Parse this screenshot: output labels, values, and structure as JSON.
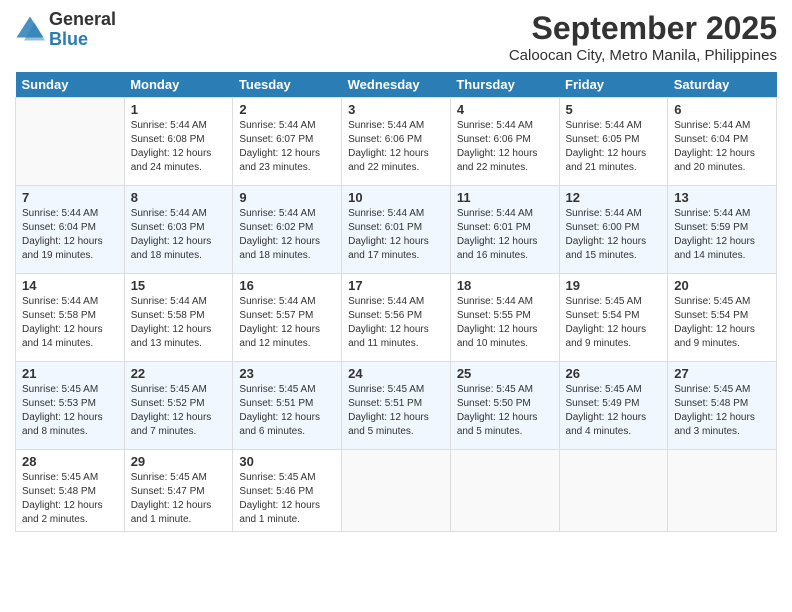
{
  "logo": {
    "general": "General",
    "blue": "Blue"
  },
  "title": "September 2025",
  "subtitle": "Caloocan City, Metro Manila, Philippines",
  "days_header": [
    "Sunday",
    "Monday",
    "Tuesday",
    "Wednesday",
    "Thursday",
    "Friday",
    "Saturday"
  ],
  "weeks": [
    [
      {
        "num": "",
        "info": ""
      },
      {
        "num": "1",
        "info": "Sunrise: 5:44 AM\nSunset: 6:08 PM\nDaylight: 12 hours\nand 24 minutes."
      },
      {
        "num": "2",
        "info": "Sunrise: 5:44 AM\nSunset: 6:07 PM\nDaylight: 12 hours\nand 23 minutes."
      },
      {
        "num": "3",
        "info": "Sunrise: 5:44 AM\nSunset: 6:06 PM\nDaylight: 12 hours\nand 22 minutes."
      },
      {
        "num": "4",
        "info": "Sunrise: 5:44 AM\nSunset: 6:06 PM\nDaylight: 12 hours\nand 22 minutes."
      },
      {
        "num": "5",
        "info": "Sunrise: 5:44 AM\nSunset: 6:05 PM\nDaylight: 12 hours\nand 21 minutes."
      },
      {
        "num": "6",
        "info": "Sunrise: 5:44 AM\nSunset: 6:04 PM\nDaylight: 12 hours\nand 20 minutes."
      }
    ],
    [
      {
        "num": "7",
        "info": "Sunrise: 5:44 AM\nSunset: 6:04 PM\nDaylight: 12 hours\nand 19 minutes."
      },
      {
        "num": "8",
        "info": "Sunrise: 5:44 AM\nSunset: 6:03 PM\nDaylight: 12 hours\nand 18 minutes."
      },
      {
        "num": "9",
        "info": "Sunrise: 5:44 AM\nSunset: 6:02 PM\nDaylight: 12 hours\nand 18 minutes."
      },
      {
        "num": "10",
        "info": "Sunrise: 5:44 AM\nSunset: 6:01 PM\nDaylight: 12 hours\nand 17 minutes."
      },
      {
        "num": "11",
        "info": "Sunrise: 5:44 AM\nSunset: 6:01 PM\nDaylight: 12 hours\nand 16 minutes."
      },
      {
        "num": "12",
        "info": "Sunrise: 5:44 AM\nSunset: 6:00 PM\nDaylight: 12 hours\nand 15 minutes."
      },
      {
        "num": "13",
        "info": "Sunrise: 5:44 AM\nSunset: 5:59 PM\nDaylight: 12 hours\nand 14 minutes."
      }
    ],
    [
      {
        "num": "14",
        "info": "Sunrise: 5:44 AM\nSunset: 5:58 PM\nDaylight: 12 hours\nand 14 minutes."
      },
      {
        "num": "15",
        "info": "Sunrise: 5:44 AM\nSunset: 5:58 PM\nDaylight: 12 hours\nand 13 minutes."
      },
      {
        "num": "16",
        "info": "Sunrise: 5:44 AM\nSunset: 5:57 PM\nDaylight: 12 hours\nand 12 minutes."
      },
      {
        "num": "17",
        "info": "Sunrise: 5:44 AM\nSunset: 5:56 PM\nDaylight: 12 hours\nand 11 minutes."
      },
      {
        "num": "18",
        "info": "Sunrise: 5:44 AM\nSunset: 5:55 PM\nDaylight: 12 hours\nand 10 minutes."
      },
      {
        "num": "19",
        "info": "Sunrise: 5:45 AM\nSunset: 5:54 PM\nDaylight: 12 hours\nand 9 minutes."
      },
      {
        "num": "20",
        "info": "Sunrise: 5:45 AM\nSunset: 5:54 PM\nDaylight: 12 hours\nand 9 minutes."
      }
    ],
    [
      {
        "num": "21",
        "info": "Sunrise: 5:45 AM\nSunset: 5:53 PM\nDaylight: 12 hours\nand 8 minutes."
      },
      {
        "num": "22",
        "info": "Sunrise: 5:45 AM\nSunset: 5:52 PM\nDaylight: 12 hours\nand 7 minutes."
      },
      {
        "num": "23",
        "info": "Sunrise: 5:45 AM\nSunset: 5:51 PM\nDaylight: 12 hours\nand 6 minutes."
      },
      {
        "num": "24",
        "info": "Sunrise: 5:45 AM\nSunset: 5:51 PM\nDaylight: 12 hours\nand 5 minutes."
      },
      {
        "num": "25",
        "info": "Sunrise: 5:45 AM\nSunset: 5:50 PM\nDaylight: 12 hours\nand 5 minutes."
      },
      {
        "num": "26",
        "info": "Sunrise: 5:45 AM\nSunset: 5:49 PM\nDaylight: 12 hours\nand 4 minutes."
      },
      {
        "num": "27",
        "info": "Sunrise: 5:45 AM\nSunset: 5:48 PM\nDaylight: 12 hours\nand 3 minutes."
      }
    ],
    [
      {
        "num": "28",
        "info": "Sunrise: 5:45 AM\nSunset: 5:48 PM\nDaylight: 12 hours\nand 2 minutes."
      },
      {
        "num": "29",
        "info": "Sunrise: 5:45 AM\nSunset: 5:47 PM\nDaylight: 12 hours\nand 1 minute."
      },
      {
        "num": "30",
        "info": "Sunrise: 5:45 AM\nSunset: 5:46 PM\nDaylight: 12 hours\nand 1 minute."
      },
      {
        "num": "",
        "info": ""
      },
      {
        "num": "",
        "info": ""
      },
      {
        "num": "",
        "info": ""
      },
      {
        "num": "",
        "info": ""
      }
    ]
  ]
}
